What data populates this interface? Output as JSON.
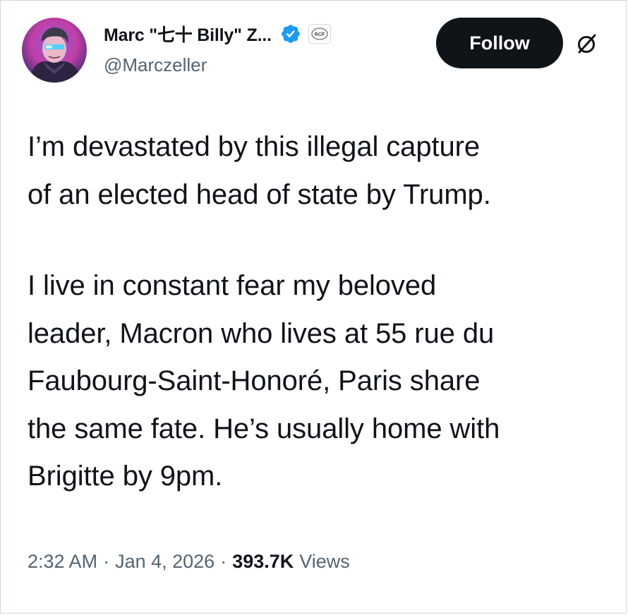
{
  "author": {
    "display_name": "Marc \"七十 Billy\" Z...",
    "handle": "@Marczeller",
    "avatar_icon": "avatar-illustration",
    "verified_icon": "verified-checkmark-icon",
    "affiliation_badge_text": "RCF"
  },
  "actions": {
    "follow_label": "Follow",
    "grok_icon": "grok-icon"
  },
  "tweet": {
    "lines": [
      "I’m devastated by this illegal capture",
      "of an elected head of state by Trump.",
      "I live in constant fear my beloved",
      "leader, Macron who lives at 55 rue du",
      "Faubourg-Saint-Honoré, Paris share",
      "the same fate. He’s usually home with",
      "Brigitte by 9pm."
    ]
  },
  "meta": {
    "time": "2:32 AM",
    "date": "Jan 4, 2026",
    "views_count": "393.7K",
    "views_label": "Views",
    "separator": "·"
  },
  "colors": {
    "text_primary": "#0f1419",
    "text_secondary": "#536471",
    "verified_blue": "#1d9bf0",
    "button_bg": "#0f1419",
    "border": "#cfd9de"
  }
}
